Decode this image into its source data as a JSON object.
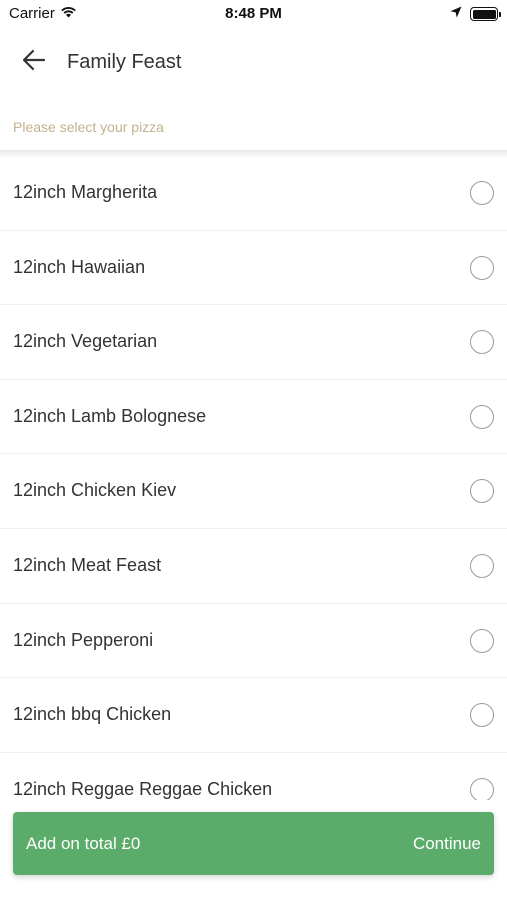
{
  "status_bar": {
    "carrier": "Carrier",
    "time": "8:48 PM",
    "icons": [
      "wifi-icon",
      "location-arrow-icon",
      "battery-icon"
    ]
  },
  "header": {
    "title": "Family Feast",
    "back_icon": "arrow-left-icon"
  },
  "subtitle": "Please select your pizza",
  "options": [
    {
      "label": "12inch Margherita",
      "selected": false
    },
    {
      "label": "12inch Hawaiian",
      "selected": false
    },
    {
      "label": "12inch Vegetarian",
      "selected": false
    },
    {
      "label": "12inch Lamb Bolognese",
      "selected": false
    },
    {
      "label": "12inch Chicken Kiev",
      "selected": false
    },
    {
      "label": "12inch Meat Feast",
      "selected": false
    },
    {
      "label": "12inch Pepperoni",
      "selected": false
    },
    {
      "label": "12inch bbq Chicken",
      "selected": false
    },
    {
      "label": "12inch Reggae Reggae Chicken",
      "selected": false
    }
  ],
  "footer": {
    "total_label": "Add on total £0",
    "continue_label": "Continue"
  },
  "colors": {
    "accent_green": "#5bab6a",
    "subtitle_gold": "#c4b08c",
    "text": "#333333",
    "radio_border": "#9a9a9a"
  }
}
